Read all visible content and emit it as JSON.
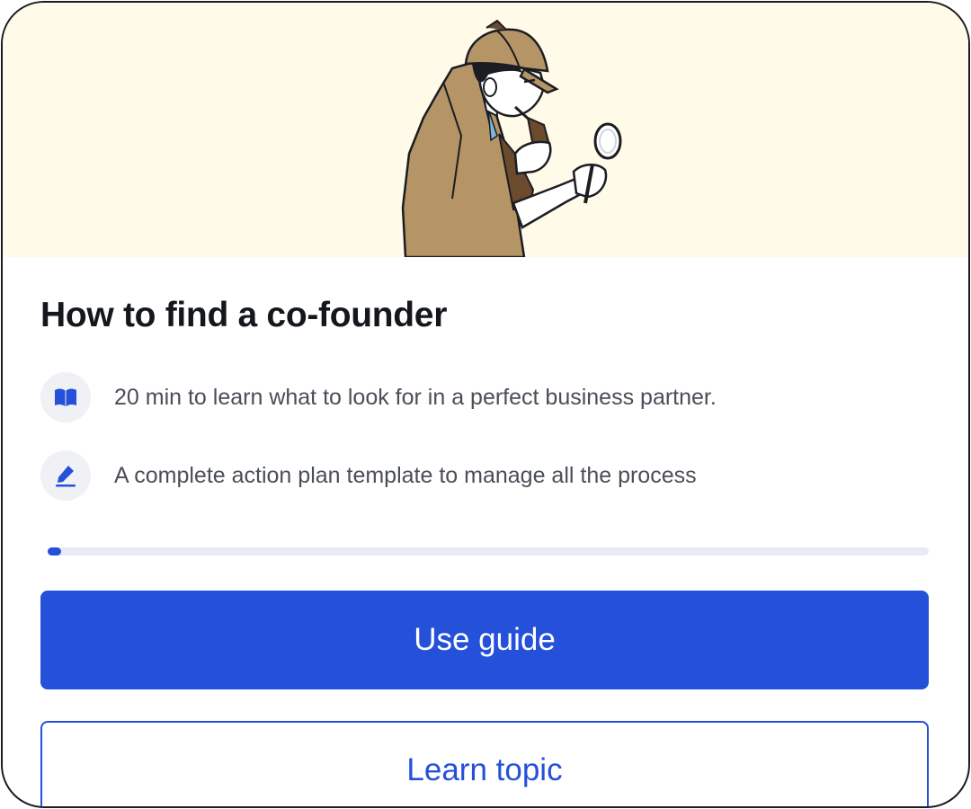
{
  "colors": {
    "accent": "#2550da",
    "hero_background": "#fffbe8",
    "text_primary": "#14171c",
    "text_secondary": "#4a4e57"
  },
  "hero": {
    "illustration": "detective-with-magnifying-glass"
  },
  "title": "How to find a co-founder",
  "features": [
    {
      "icon": "book-icon",
      "text": "20 min to learn what to look for in a perfect business partner."
    },
    {
      "icon": "pencil-icon",
      "text": "A complete action plan template to manage all the process"
    }
  ],
  "progress": {
    "value": 0.015
  },
  "buttons": {
    "primary_label": "Use guide",
    "secondary_label": "Learn topic"
  }
}
